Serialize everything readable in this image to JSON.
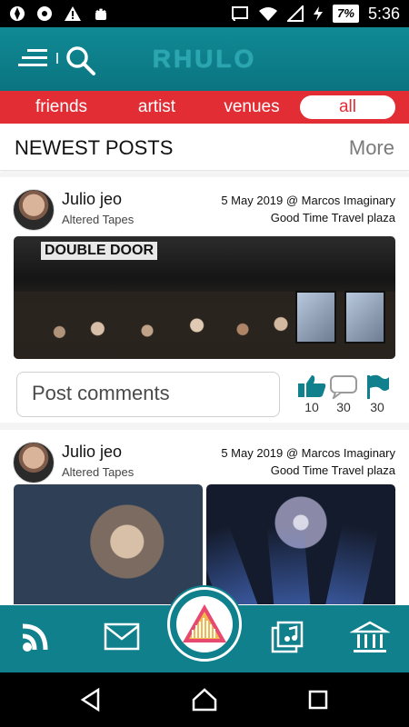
{
  "status_bar": {
    "battery": "7%",
    "time": "5:36"
  },
  "header": {
    "brand": "RHULO"
  },
  "tabs": [
    {
      "label": "friends",
      "active": false
    },
    {
      "label": "artist",
      "active": false
    },
    {
      "label": "venues",
      "active": false
    },
    {
      "label": "all",
      "active": true
    }
  ],
  "section": {
    "title": "NEWEST POSTS",
    "more": "More"
  },
  "posts": [
    {
      "author": "Julio jeo",
      "band": "Altered Tapes",
      "meta_line1": "5 May 2019 @ Marcos Imaginary",
      "meta_line2": "Good Time Travel plaza",
      "photo_sign": "DOUBLE DOOR",
      "comment_placeholder": "Post comments",
      "likes": "10",
      "comments": "30",
      "flags": "30"
    },
    {
      "author": "Julio jeo",
      "band": "Altered Tapes",
      "meta_line1": "5 May 2019 @ Marcos Imaginary",
      "meta_line2": "Good Time Travel plaza"
    }
  ],
  "icons": {
    "menu": "menu-icon",
    "search": "search-icon",
    "like": "thumbs-up-icon",
    "comment": "speech-bubble-icon",
    "flag": "flag-icon",
    "feed": "rss-icon",
    "mail": "mail-icon",
    "center": "triangle-logo-icon",
    "music": "music-library-icon",
    "venue": "building-icon",
    "back": "back-triangle-icon",
    "home": "home-icon",
    "recents": "square-icon"
  },
  "colors": {
    "teal": "#0f808c",
    "red": "#e22d34"
  }
}
